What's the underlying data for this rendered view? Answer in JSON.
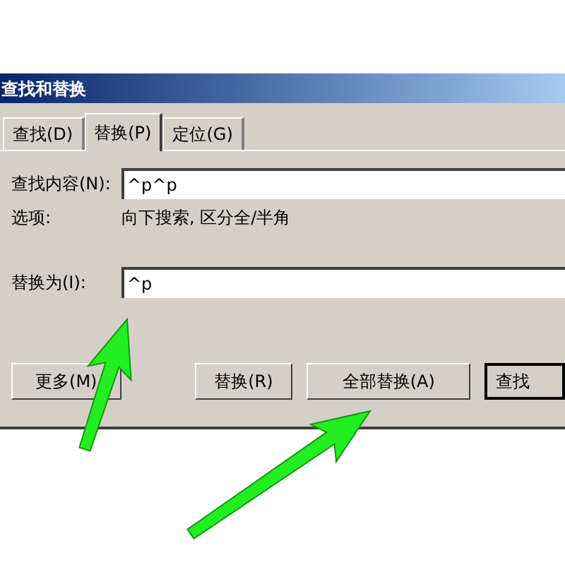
{
  "window": {
    "title": "查找和替换"
  },
  "tabs": [
    {
      "label": "查找(D)",
      "selected": false
    },
    {
      "label": "替换(P)",
      "selected": true
    },
    {
      "label": "定位(G)",
      "selected": false
    }
  ],
  "find": {
    "label": "查找内容(N):",
    "value": "^p^p"
  },
  "options": {
    "label": "选项:",
    "value": "向下搜索, 区分全/半角"
  },
  "replace": {
    "label": "替换为(I):",
    "value": "^p"
  },
  "buttons": [
    {
      "label": "更多(M)",
      "default": false
    },
    {
      "label": "替换(R)",
      "default": false
    },
    {
      "label": "全部替换(A)",
      "default": false
    },
    {
      "label": "查找",
      "default": true
    }
  ]
}
